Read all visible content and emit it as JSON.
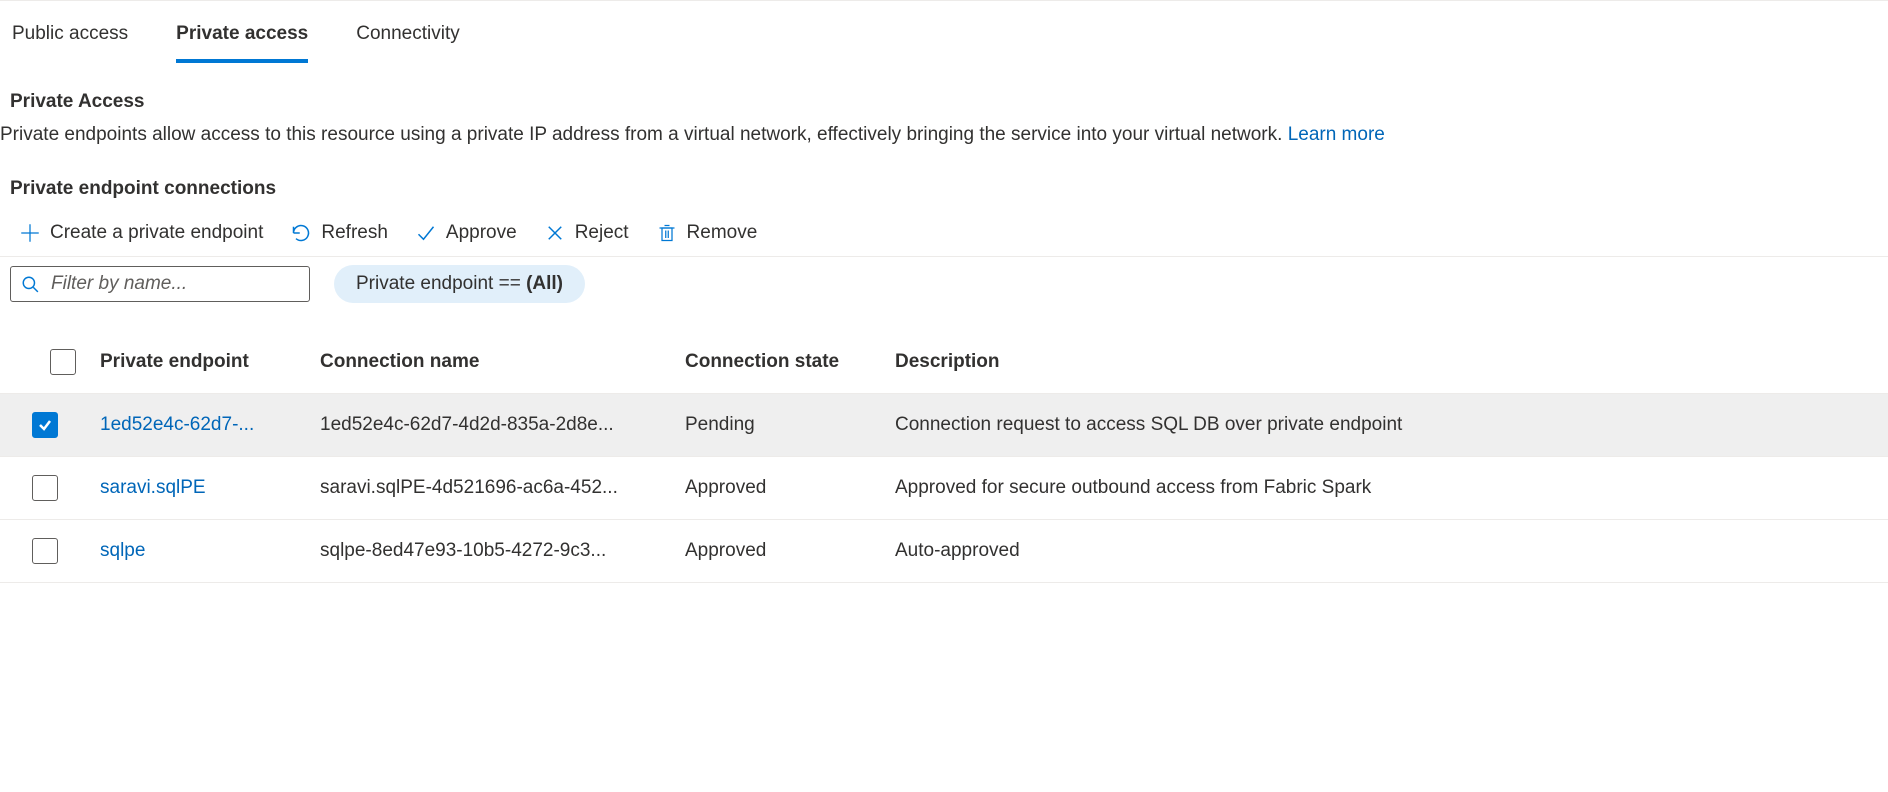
{
  "tabs": [
    {
      "label": "Public access",
      "active": false
    },
    {
      "label": "Private access",
      "active": true
    },
    {
      "label": "Connectivity",
      "active": false
    }
  ],
  "section": {
    "title": "Private Access",
    "description": "Private endpoints allow access to this resource using a private IP address from a virtual network, effectively bringing the service into your virtual network. ",
    "learn_more": "Learn more"
  },
  "subsection_title": "Private endpoint connections",
  "toolbar": {
    "create": "Create a private endpoint",
    "refresh": "Refresh",
    "approve": "Approve",
    "reject": "Reject",
    "remove": "Remove"
  },
  "filter": {
    "placeholder": "Filter by name...",
    "pill_prefix": "Private endpoint == ",
    "pill_value": "(All)"
  },
  "table": {
    "headers": {
      "endpoint": "Private endpoint",
      "connection": "Connection name",
      "state": "Connection state",
      "description": "Description"
    },
    "rows": [
      {
        "checked": true,
        "endpoint": "1ed52e4c-62d7-...",
        "connection": "1ed52e4c-62d7-4d2d-835a-2d8e...",
        "state": "Pending",
        "description": "Connection request to access SQL DB over private endpoint"
      },
      {
        "checked": false,
        "endpoint": "saravi.sqlPE",
        "connection": "saravi.sqlPE-4d521696-ac6a-452...",
        "state": "Approved",
        "description": "Approved for secure outbound access from Fabric Spark"
      },
      {
        "checked": false,
        "endpoint": "sqlpe",
        "connection": "sqlpe-8ed47e93-10b5-4272-9c3...",
        "state": "Approved",
        "description": "Auto-approved"
      }
    ]
  }
}
